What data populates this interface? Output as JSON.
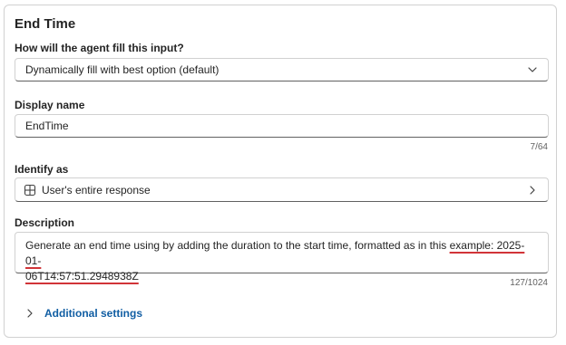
{
  "panel": {
    "title": "End Time"
  },
  "fill": {
    "label": "How will the agent fill this input?",
    "value": "Dynamically fill with best option (default)",
    "icon": "chevron-down-icon"
  },
  "display_name": {
    "label": "Display name",
    "value": "EndTime",
    "counter": "7/64"
  },
  "identify": {
    "label": "Identify as",
    "value": "User's entire response",
    "icon": "entity-icon",
    "chevron": "chevron-right-icon"
  },
  "description": {
    "label": "Description",
    "text_plain": "Generate an end time using by adding the duration to the start time, formatted as in this ",
    "text_flagged_1": "example: 2025-01-",
    "text_flagged_2": "06T14:57:51.2948938Z",
    "counter": "127/1024"
  },
  "additional": {
    "label": "Additional settings",
    "icon": "chevron-right-icon"
  },
  "colors": {
    "accent": "#115ea3",
    "spellcheck": "#d13438",
    "border": "#d1d1d1"
  }
}
